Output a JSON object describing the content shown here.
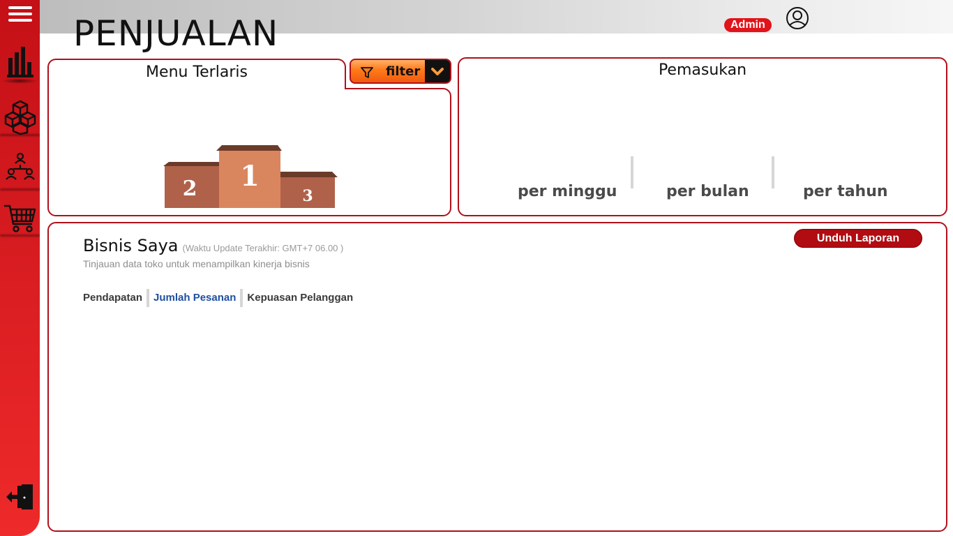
{
  "header": {
    "title": "PENJUALAN",
    "user_badge": "Admin",
    "user_icon": "user-circle-icon"
  },
  "sidebar": {
    "items": [
      {
        "name": "menu",
        "icon": "hamburger-icon"
      },
      {
        "name": "sales",
        "icon": "bar-chart-icon",
        "active": true
      },
      {
        "name": "products",
        "icon": "boxes-icon"
      },
      {
        "name": "network",
        "icon": "users-network-icon"
      },
      {
        "name": "cart",
        "icon": "shopping-cart-icon"
      },
      {
        "name": "logout",
        "icon": "logout-door-icon"
      }
    ]
  },
  "best_menu": {
    "title": "Menu Terlaris",
    "filter_label": "filter",
    "podium": {
      "first": "1",
      "second": "2",
      "third": "3"
    }
  },
  "income": {
    "title": "Pemasukan",
    "periods": [
      "per minggu",
      "per bulan",
      "per tahun"
    ]
  },
  "business": {
    "title": "Bisnis Saya",
    "update_note": "(Waktu Update Terakhir: GMT+7 06.00 )",
    "subtitle": "Tinjauan data toko untuk menampilkan kinerja bisnis",
    "download_label": "Unduh Laporan",
    "tabs": [
      {
        "label": "Pendapatan",
        "active": false
      },
      {
        "label": "Jumlah Pesanan",
        "active": true
      },
      {
        "label": "Kepuasan Pelanggan",
        "active": false
      }
    ]
  },
  "colors": {
    "brand_red": "#c41016",
    "accent_orange": "#ff7a1a",
    "active_tab": "#1f4fa0"
  }
}
